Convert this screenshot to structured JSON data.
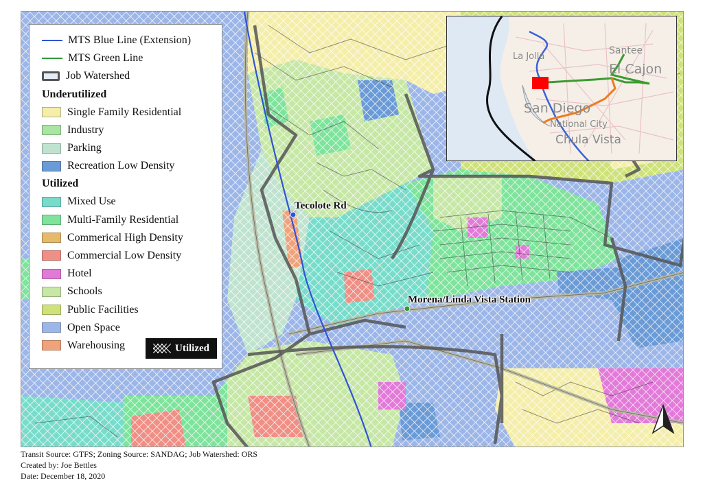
{
  "legend": {
    "lines": [
      {
        "label": "MTS Blue Line (Extension)",
        "color": "#2f54d6"
      },
      {
        "label": "MTS Green Line",
        "color": "#2e9a3a"
      },
      {
        "label": "Job Watershed",
        "color": "#555555"
      }
    ],
    "underutilized_heading": "Underutilized",
    "underutilized": [
      {
        "label": "Single Family Residential",
        "color": "#f4eeaa"
      },
      {
        "label": "Industry",
        "color": "#a9e6a1"
      },
      {
        "label": "Parking",
        "color": "#bfe3cf"
      },
      {
        "label": "Recreation Low Density",
        "color": "#6b9bd6"
      }
    ],
    "utilized_heading": "Utilized",
    "utilized": [
      {
        "label": "Mixed Use",
        "color": "#79dccb"
      },
      {
        "label": "Multi-Family Residential",
        "color": "#7fe39c"
      },
      {
        "label": "Commerical High Density",
        "color": "#e6b96b"
      },
      {
        "label": "Commercial Low Density",
        "color": "#ef8f85"
      },
      {
        "label": "Hotel",
        "color": "#e27ad8"
      },
      {
        "label": "Schools",
        "color": "#c6e7a6"
      },
      {
        "label": "Public Facilities",
        "color": "#cfe27a"
      },
      {
        "label": "Open Space",
        "color": "#9db6e8"
      },
      {
        "label": "Warehousing",
        "color": "#f0a27a"
      }
    ],
    "utilized_badge": "Utilized"
  },
  "stations": [
    {
      "name": "Tecolote Rd"
    },
    {
      "name": "Morena/Linda Vista Station"
    }
  ],
  "inset": {
    "labels": [
      "La Jolla",
      "Santee",
      "El Cajon",
      "San Diego",
      "National City",
      "Chula Vista"
    ],
    "line_colors": {
      "blue": "#3a62d8",
      "green": "#3b9b2f",
      "orange": "#f07b1c",
      "marker": "#ff0000"
    }
  },
  "credits": {
    "line1": "Transit Source: GTFS; Zoning Source: SANDAG; Job Watershed: ORS",
    "line2": "Created by: Joe Bettles",
    "line3": "Date: December 18, 2020"
  }
}
